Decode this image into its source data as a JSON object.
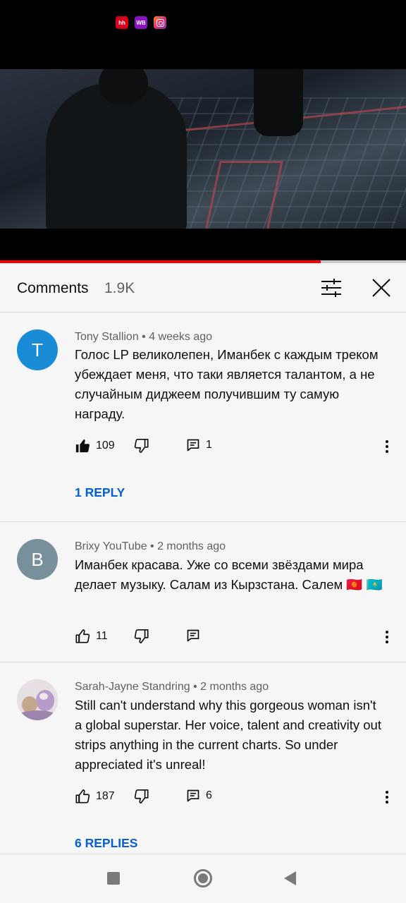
{
  "status_bar": {
    "icons": [
      {
        "name": "hh-app-icon",
        "label": "hh"
      },
      {
        "name": "wb-app-icon",
        "label": "WB"
      },
      {
        "name": "instagram-icon",
        "label": ""
      }
    ]
  },
  "video": {
    "progress": 0.79
  },
  "comments_header": {
    "title": "Comments",
    "count": "1.9K"
  },
  "comments": [
    {
      "avatar_letter": "T",
      "avatar_color": "#1a8bd6",
      "meta": "Tony Stallion • 4 weeks ago",
      "text": "Голос LP великолепен, Иманбек с каждым треком убеждает меня, что таки является талантом, а не случайным диджеем получившим ту самую награду.",
      "likes": "109",
      "liked": true,
      "replies_count": "1",
      "reply_link": "1 REPLY"
    },
    {
      "avatar_letter": "B",
      "avatar_color": "#78909c",
      "meta": "Brixy YouTube • 2 months ago",
      "text": "Иманбек красава. Уже со всеми звёздами мира делает музыку. Салам из Кырзстана. Салем",
      "flag_emoji_1": "🇰🇬",
      "flag_emoji_2": "🇰🇿",
      "likes": "11",
      "liked": false,
      "replies_count": "",
      "reply_link": ""
    },
    {
      "avatar_letter": "",
      "avatar_color": "#d8cfd6",
      "meta": "Sarah-Jayne Standring • 2 months ago",
      "text": "Still can't understand why this gorgeous woman isn't a global superstar. Her voice, talent and creativity out strips anything in the current charts. So under appreciated  it's unreal!",
      "likes": "187",
      "liked": false,
      "replies_count": "6",
      "reply_link": "6 REPLIES"
    }
  ],
  "colors": {
    "accent_link": "#065fd4",
    "progress_red": "#ff0000",
    "background": "#f6f6f6"
  }
}
